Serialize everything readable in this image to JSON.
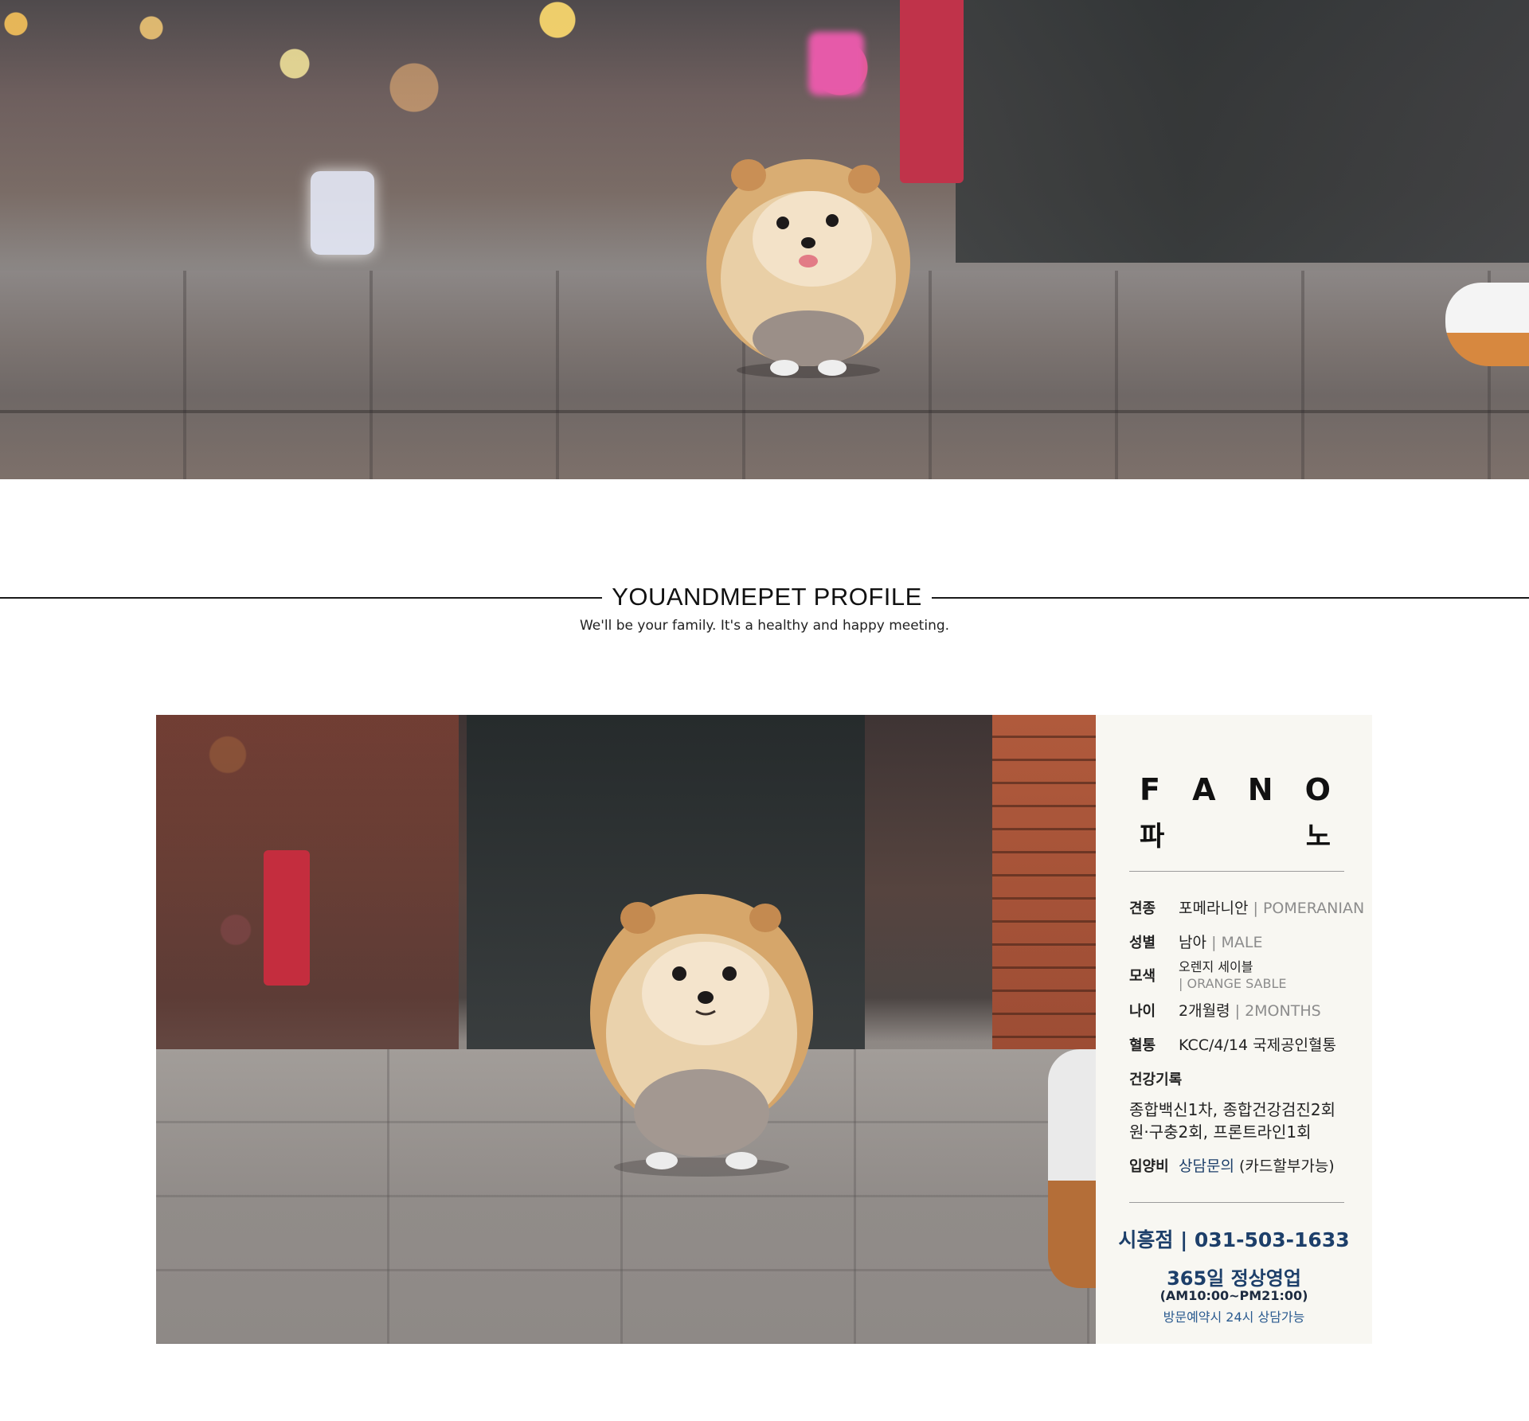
{
  "hero": {
    "alt": "hero-photo"
  },
  "section": {
    "title": "YOUANDMEPET PROFILE",
    "subtitle": "We'll be your family. It's a healthy and happy meeting."
  },
  "profile": {
    "name_en": [
      "F",
      "A",
      "N",
      "O"
    ],
    "name_ko": [
      "파",
      "노"
    ],
    "breed_label": "견종",
    "breed_ko": "포메라니안",
    "breed_en": "| POMERANIAN",
    "sex_label": "성별",
    "sex_ko": "남아",
    "sex_en": "| MALE",
    "color_label": "모색",
    "color_ko": "오렌지 세이블",
    "color_en": "| ORANGE SABLE",
    "age_label": "나이",
    "age_ko": "2개월령",
    "age_en": "| 2MONTHS",
    "pedigree_label": "혈통",
    "pedigree_value": "KCC/4/14 국제공인혈통",
    "health_label": "건강기록",
    "health_line1": "종합백신1차, 종합건강검진2회",
    "health_line2": "원·구충2회, 프론트라인1회",
    "fee_label": "입양비",
    "fee_value": "상담문의",
    "fee_note": "(카드할부가능)"
  },
  "contact": {
    "branch_phone": "시흥점 | 031-503-1633",
    "open": "365일 정상영업",
    "hours": "(AM10:00~PM21:00)",
    "reservation": "방문예약시 24시 상담가능"
  },
  "colors": {
    "accent": "#1d3f6a",
    "panel_bg": "#f8f7f2",
    "muted": "#8c8c8c"
  }
}
